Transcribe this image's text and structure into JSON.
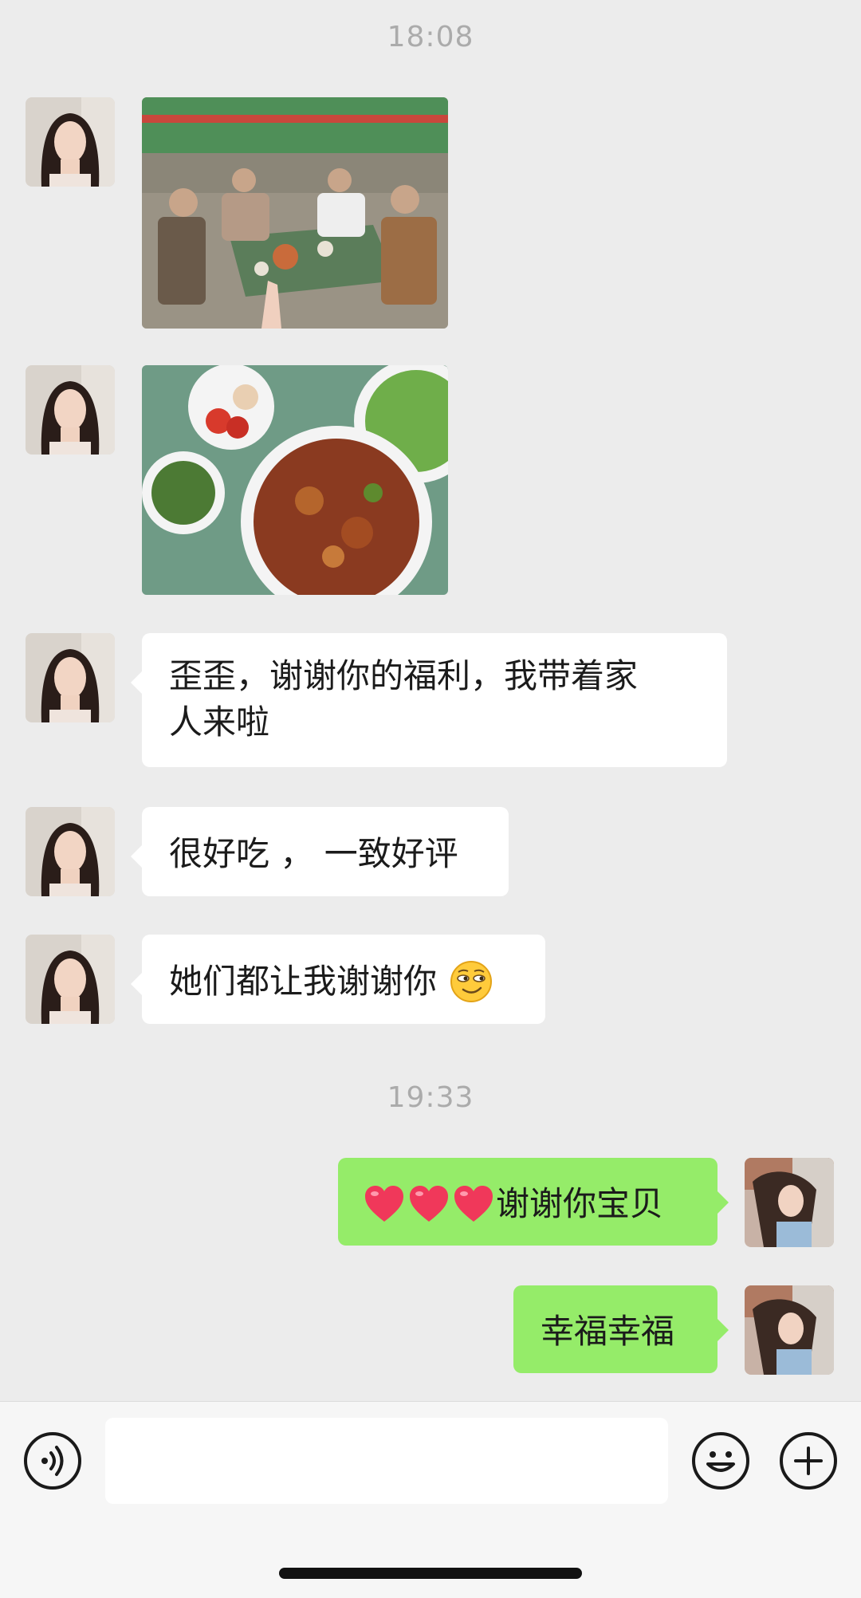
{
  "timestamps": [
    "18:08",
    "19:33"
  ],
  "messages": {
    "m3": {
      "line1": "歪歪，谢谢你的福利，我带着家",
      "line2": "人来啦"
    },
    "m4": {
      "text": "很好吃 ， 一致好评"
    },
    "m5": {
      "text": "她们都让我谢谢你",
      "emoji": "smirk-emoji"
    },
    "m6": {
      "text": "谢谢你宝贝",
      "hearts": 3
    },
    "m7": {
      "text": "幸福幸福"
    }
  },
  "photos": [
    {
      "name": "photo-family-dinner",
      "desc_icon": "photo"
    },
    {
      "name": "photo-dishes",
      "desc_icon": "photo"
    }
  ],
  "input": {
    "placeholder": "",
    "value": ""
  },
  "icons": {
    "voice": "voice-icon",
    "emoji": "emoji-icon",
    "plus": "plus-icon"
  },
  "colors": {
    "background": "#ececec",
    "incoming_bubble": "#ffffff",
    "outgoing_bubble": "#95ec69",
    "timestamp": "#ababab"
  }
}
